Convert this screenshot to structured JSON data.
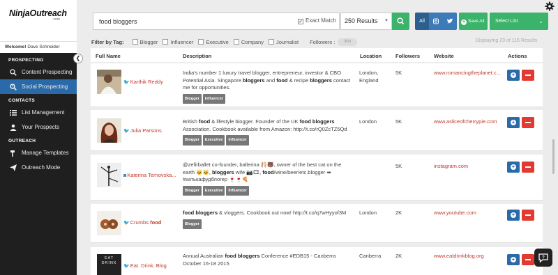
{
  "sidebar": {
    "logo_main": "NinjaOutreach",
    "logo_sub": ".com",
    "welcome_prefix": "Welcome!",
    "welcome_user": "Dave Schneider",
    "sections": [
      {
        "title": "PROSPECTING",
        "items": [
          {
            "label": "Content Prospecting",
            "icon": "search-icon",
            "active": false
          },
          {
            "label": "Social Prospecting",
            "icon": "search-people-icon",
            "active": true
          }
        ]
      },
      {
        "title": "CONTACTS",
        "items": [
          {
            "label": "List Management",
            "icon": "list-icon",
            "active": false
          },
          {
            "label": "Your Prospects",
            "icon": "person-icon",
            "active": false
          }
        ]
      },
      {
        "title": "OUTREACH",
        "items": [
          {
            "label": "Manage Templates",
            "icon": "hammer-icon",
            "active": false
          },
          {
            "label": "Outreach Mode",
            "icon": "paper-plane-icon",
            "active": false
          }
        ]
      }
    ]
  },
  "search": {
    "query": "food bloggers",
    "exact_match_label": "Exact Match",
    "exact_match_checked": true,
    "results_label": "250 Results"
  },
  "toolbar": {
    "all_label": "All",
    "save_all_label": "Save All",
    "select_list_label": "Select List"
  },
  "filters": {
    "label": "Filter by Tag:",
    "tags": [
      "Blogger",
      "Influencer",
      "Executive",
      "Company",
      "Journalist"
    ],
    "followers_label": "Followers :",
    "min_placeholder": "Min"
  },
  "displaying": "Displaying 23 of 115 Results",
  "table": {
    "headers": {
      "name": "Full Name",
      "description": "Description",
      "location": "Location",
      "followers": "Followers",
      "website": "Website",
      "actions": "Actions"
    },
    "rows": [
      {
        "name": "Karthik Reddy",
        "network": "twitter",
        "description_html": "India's number 1 luxury travel blogger, entrepreneur, investor & CBO Potential Asia. Singapore <b>bloggers</b> and <b>food</b> & recipe <b>bloggers</b> contact me for opportunities.",
        "tags": [
          "Blogger",
          "Influencer"
        ],
        "location": "London, England",
        "followers": "5K",
        "website": "www.romancingtheplanet.c..."
      },
      {
        "name": "Julia Parsons",
        "network": "twitter",
        "description_html": "British <b>food</b> & lifestyle blogger. Founder of the UK <b>food bloggers</b> Association. Cookbook available from Amazon: http://t.co/rQ0ZcTZ5Qd",
        "tags": [
          "Blogger",
          "Executive",
          "Influencer"
        ],
        "location": "London",
        "followers": "5K",
        "website": "www.asliceofcherrypie.com"
      },
      {
        "name": "Katerina Ternovska...",
        "network": "instagram",
        "description_html": "@zefirballet co-founder, ballerina 🩰🐻, owner of the best cat on the earth 🐱🐱, <b>bloggers</b> wife 📷🎞, <b>food</b>/wine/beer/etc.blogger ➡ #катькафудблогер 🍷🍷🍕",
        "tags": [
          "Blogger",
          "Executive",
          "Influencer"
        ],
        "location": "",
        "followers": "5K",
        "website": "instagram.com"
      },
      {
        "name": "Crumbs food",
        "name_plain": "Crumbs",
        "name_bold": "food",
        "network": "twitter",
        "description_html": "<b>food bloggers</b> & vloggers. Cookbook out now! http://t.co/q7wHyyof3M",
        "tags": [
          "Blogger"
        ],
        "location": "London",
        "followers": "2K",
        "website": "www.youtube.com"
      },
      {
        "name": "Eat. Drink. Blog",
        "network": "twitter",
        "description_html": "Annual Australian <b>food bloggers</b> Conference #EDB15 - Canberra October 16-18 2015",
        "tags": [],
        "location": "Canberra",
        "followers": "2K",
        "website": "www.eatdrinkblog.org",
        "thumb_text": "EAT DRINK"
      }
    ]
  },
  "colors": {
    "sidebar_bg": "#1f1f1f",
    "active_nav": "#2b6aa8",
    "green": "#3bb36a",
    "blue": "#2b6aa8",
    "red": "#e03a32",
    "link_red": "#c0392b"
  }
}
